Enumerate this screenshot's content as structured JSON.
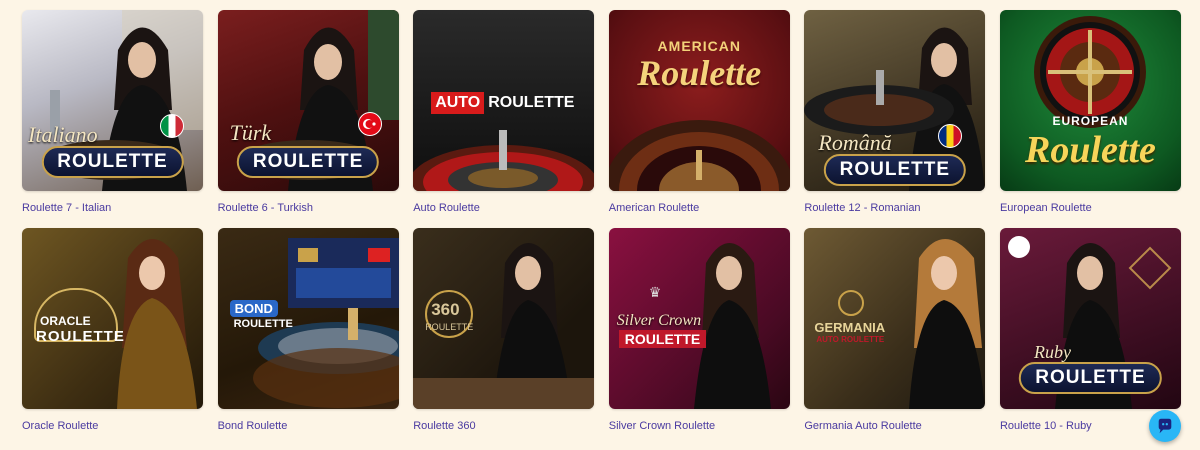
{
  "games": [
    {
      "title": "Roulette 7 - Italian",
      "logo_script": "Italiano",
      "logo_text": "ROULETTE"
    },
    {
      "title": "Roulette 6 - Turkish",
      "logo_script": "Türk",
      "logo_text": "ROULETTE"
    },
    {
      "title": "Auto Roulette",
      "logo_a": "AUTO",
      "logo_b": "ROULETTE"
    },
    {
      "title": "American Roulette",
      "logo_a": "AMERICAN",
      "logo_b": "Roulette"
    },
    {
      "title": "Roulette 12 - Romanian",
      "logo_script": "Română",
      "logo_text": "ROULETTE"
    },
    {
      "title": "European Roulette",
      "logo_a": "EUROPEAN",
      "logo_b": "Roulette"
    },
    {
      "title": "Oracle Roulette",
      "logo_a": "ORACLE",
      "logo_b": "ROULETTE"
    },
    {
      "title": "Bond Roulette",
      "logo_a": "BOND",
      "logo_b": "ROULETTE"
    },
    {
      "title": "Roulette 360",
      "logo_a": "360",
      "logo_b": "ROULETTE"
    },
    {
      "title": "Silver Crown Roulette",
      "logo_a": "Silver Crown",
      "logo_b": "ROULETTE"
    },
    {
      "title": "Germania Auto Roulette",
      "logo_a": "GERMANIA",
      "logo_b": "AUTO ROULETTE"
    },
    {
      "title": "Roulette 10 - Ruby",
      "logo_script": "Ruby",
      "logo_text": "ROULETTE"
    }
  ],
  "colors": {
    "page_bg": "#fdf5e6",
    "title_text": "#4a3aa0",
    "chat_button": "#29b6f6"
  },
  "icons": {
    "chat": "chat-bubble-icon"
  }
}
